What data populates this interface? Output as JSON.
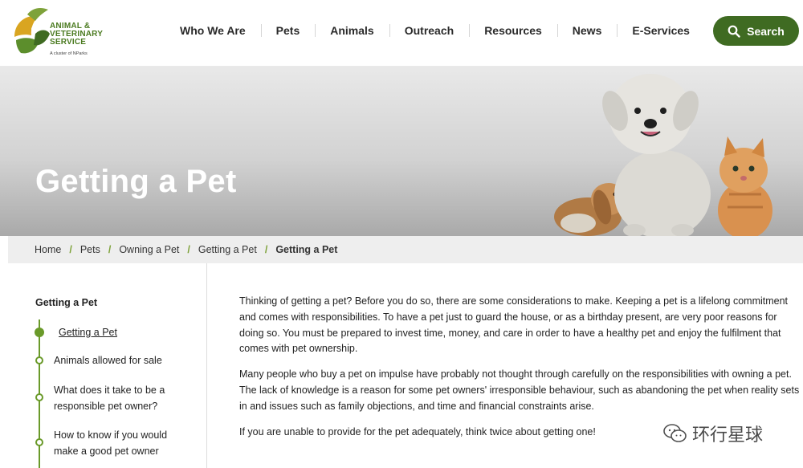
{
  "brand": {
    "name_lines": [
      "ANIMAL &",
      "VETERINARY",
      "SERVICE"
    ],
    "tagline": "A cluster of NParks",
    "primary_color": "#3f6b22",
    "accent_color": "#7ea23a"
  },
  "nav": {
    "items": [
      {
        "label": "Who We Are"
      },
      {
        "label": "Pets"
      },
      {
        "label": "Animals"
      },
      {
        "label": "Outreach"
      },
      {
        "label": "Resources"
      },
      {
        "label": "News"
      },
      {
        "label": "E-Services"
      }
    ],
    "search_label": "Search",
    "search_icon": "search-icon"
  },
  "hero": {
    "title": "Getting a Pet",
    "image": "dog-cat-rabbit-photo"
  },
  "breadcrumb": {
    "items": [
      {
        "label": "Home"
      },
      {
        "label": "Pets"
      },
      {
        "label": "Owning a Pet"
      },
      {
        "label": "Getting a Pet"
      },
      {
        "label": "Getting a Pet"
      }
    ],
    "separator": "/"
  },
  "sidebar": {
    "title": "Getting a Pet",
    "items": [
      {
        "label": "Getting a Pet",
        "active": true
      },
      {
        "label": "Animals allowed for sale",
        "active": false
      },
      {
        "label": "What does it take to be a responsible pet owner?",
        "active": false
      },
      {
        "label": "How to know if you would make a good pet owner",
        "active": false
      }
    ]
  },
  "content": {
    "paragraphs": [
      "Thinking of getting a pet? Before you do so, there are some considerations to make. Keeping a pet is a lifelong commitment and comes with responsibilities. To have a pet just to guard the house, or as a birthday present, are very poor reasons for doing so. You must be prepared to invest time, money, and care in order to have a healthy pet and enjoy the fulfilment that comes with pet ownership.",
      "Many people who buy a pet on impulse have probably not thought through carefully on the responsibilities with owning a pet. The lack of knowledge is a reason for some pet owners' irresponsible behaviour, such as abandoning the pet when reality sets in and issues such as family objections, and time and financial constraints arise.",
      "If you are unable to provide for the pet adequately, think twice about getting one!"
    ]
  },
  "watermark": {
    "text": "环行星球",
    "icon": "wechat-icon"
  }
}
